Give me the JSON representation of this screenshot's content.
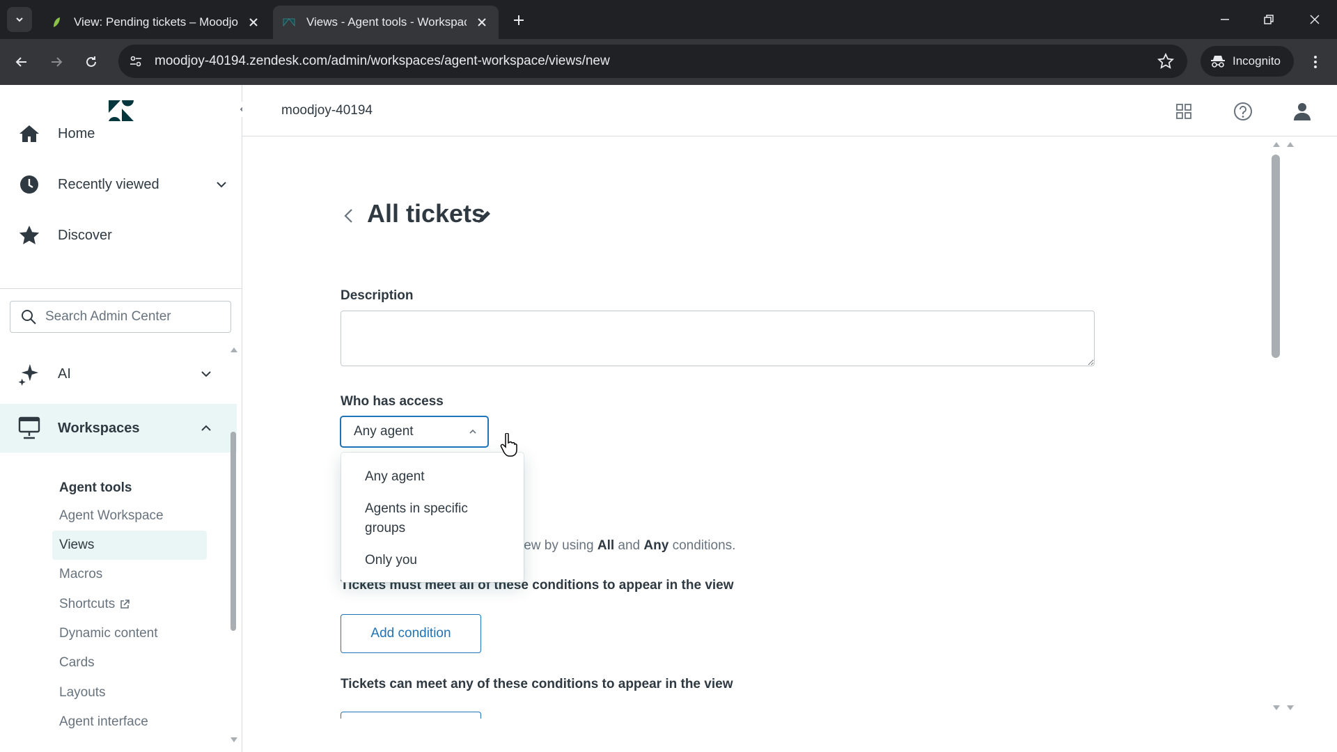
{
  "browser": {
    "tabs": [
      {
        "title": "View: Pending tickets – Moodjoy",
        "active": false
      },
      {
        "title": "Views - Agent tools - Workspaces",
        "active": true
      }
    ],
    "url": "moodjoy-40194.zendesk.com/admin/workspaces/agent-workspace/views/new",
    "incognito_label": "Incognito"
  },
  "sidebar": {
    "nav": [
      {
        "label": "Home",
        "icon": "home-icon"
      },
      {
        "label": "Recently viewed",
        "icon": "clock-icon"
      },
      {
        "label": "Discover",
        "icon": "star-icon"
      }
    ],
    "search_placeholder": "Search Admin Center",
    "sections": [
      {
        "label": "AI",
        "icon": "sparkle-icon",
        "expanded": false
      },
      {
        "label": "Workspaces",
        "icon": "monitor-icon",
        "expanded": true
      }
    ],
    "sub_header": "Agent tools",
    "sub_items": [
      "Agent Workspace",
      "Views",
      "Macros",
      "Shortcuts",
      "Dynamic content",
      "Cards",
      "Layouts",
      "Agent interface"
    ],
    "selected_sub_item": "Views"
  },
  "header": {
    "account": "moodjoy-40194"
  },
  "main": {
    "title": "All tickets",
    "description_label": "Description",
    "description_value": "",
    "access_label": "Who has access",
    "access_selected": "Any agent",
    "access_options": [
      "Any agent",
      "Agents in specific groups",
      "Only you"
    ],
    "conditions_text_pre": "iew by using ",
    "conditions_all": "All",
    "conditions_and": " and ",
    "conditions_any": "Any",
    "conditions_text_post": " conditions.",
    "all_heading": "Tickets must meet all of these conditions to appear in the view",
    "any_heading": "Tickets can meet any of these conditions to appear in the view",
    "add_condition": "Add condition"
  },
  "colors": {
    "accent": "#1f73b7",
    "selected_bg": "#e9f6f5",
    "chrome_dark": "#202124",
    "chrome_mid": "#35363a"
  }
}
